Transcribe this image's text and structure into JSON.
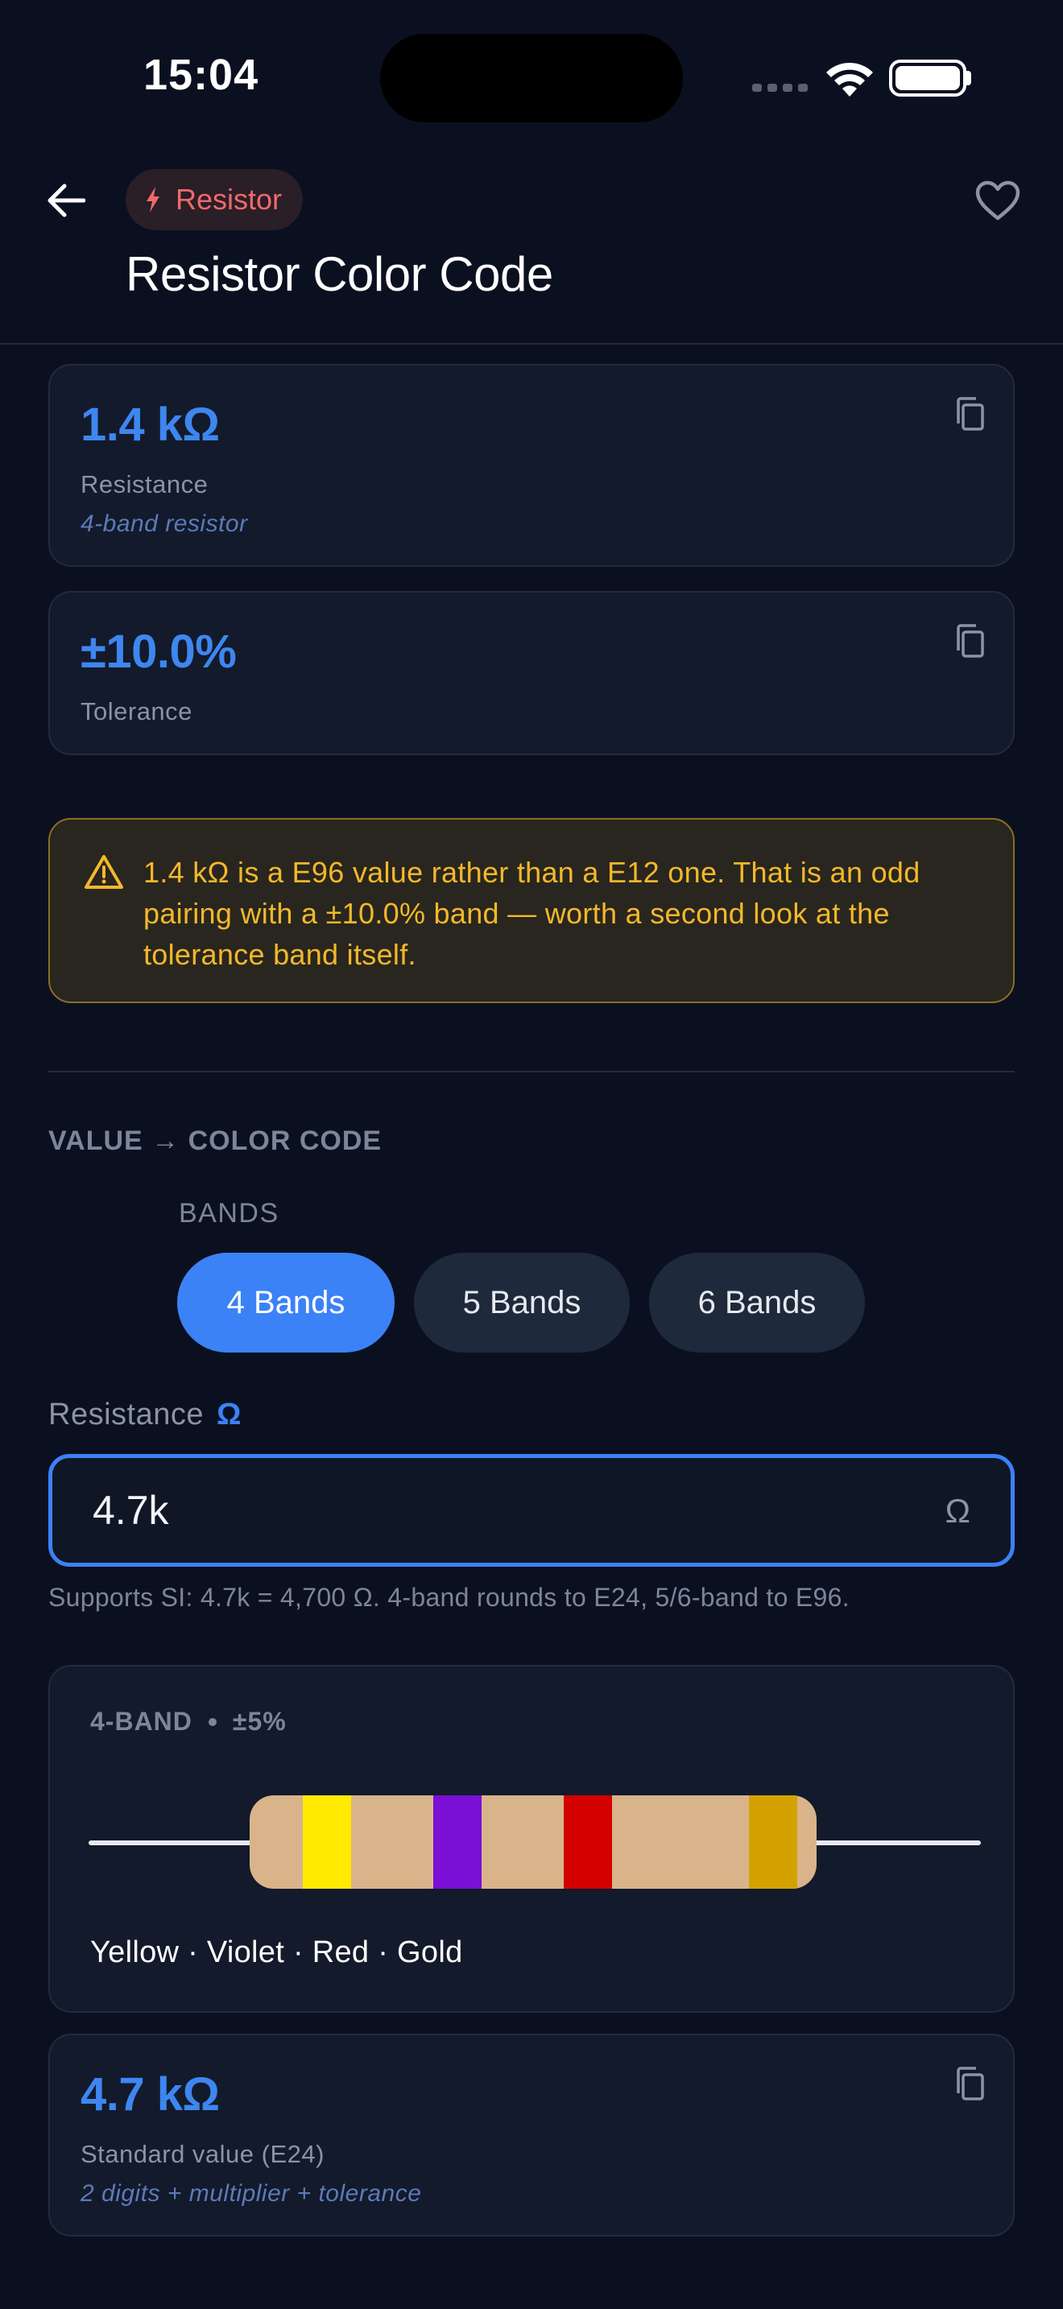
{
  "status": {
    "time": "15:04"
  },
  "header": {
    "chip_label": "Resistor",
    "title": "Resistor Color Code"
  },
  "resistance_card": {
    "value": "1.4 kΩ",
    "label": "Resistance",
    "sub": "4-band resistor"
  },
  "tolerance_card": {
    "value": "±10.0%",
    "label": "Tolerance"
  },
  "warning": {
    "text": "1.4 kΩ is a E96 value rather than a E12 one. That is an odd pairing with a ±10.0% band — worth a second look at the tolerance band itself."
  },
  "section": {
    "title": "VALUE → COLOR CODE",
    "bands_label": "BANDS",
    "band_options": [
      "4 Bands",
      "5 Bands",
      "6 Bands"
    ],
    "selected_band_option": "4 Bands"
  },
  "input": {
    "label": "Resistance",
    "unit_label": "Ω",
    "value": "4.7k",
    "suffix": "Ω",
    "hint": "Supports SI: 4.7k = 4,700 Ω. 4-band rounds to E24, 5/6-band to E96."
  },
  "resistor_visual": {
    "type_label": "4-BAND",
    "tolerance_label": "±5%",
    "bands": [
      {
        "name": "Yellow",
        "color": "#ffea00"
      },
      {
        "name": "Violet",
        "color": "#7a0fd6"
      },
      {
        "name": "Red",
        "color": "#d40000"
      },
      {
        "name": "Gold",
        "color": "#d4a200"
      }
    ],
    "body_color": "#d9b48a",
    "names_text": "Yellow · Violet · Red · Gold"
  },
  "standard_card": {
    "value": "4.7 kΩ",
    "label": "Standard value (E24)",
    "sub": "2 digits + multiplier + tolerance"
  },
  "colors": {
    "accent": "#3b82f6",
    "warning": "#f3b82a",
    "danger": "#ef6a6a",
    "background": "#0b1020"
  }
}
